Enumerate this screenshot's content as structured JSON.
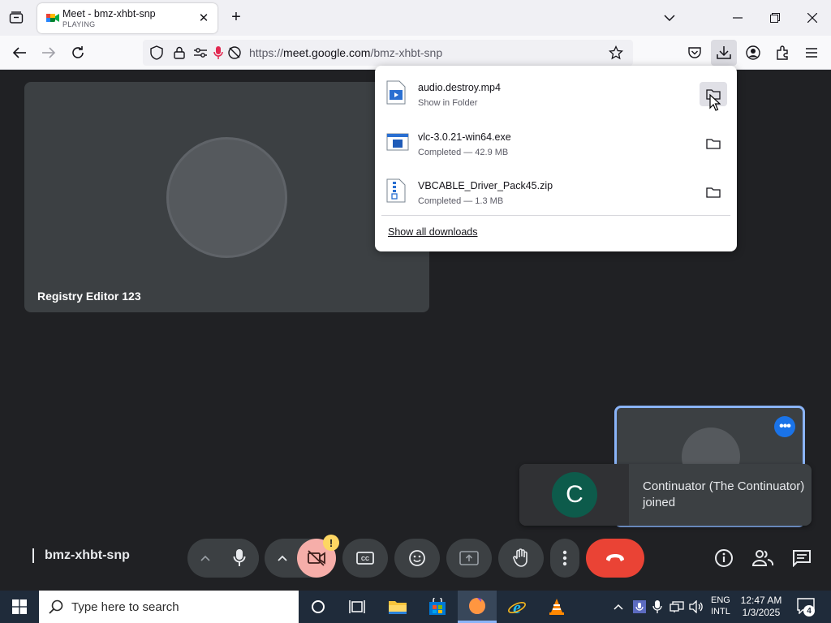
{
  "browser": {
    "tab": {
      "title": "Meet - bmz-xhbt-snp",
      "subtitle": "PLAYING"
    },
    "url": {
      "scheme": "https://",
      "host": "meet.google.com",
      "path": "/bmz-xhbt-snp"
    }
  },
  "downloads": {
    "items": [
      {
        "name": "audio.destroy.mp4",
        "status": "Show in Folder"
      },
      {
        "name": "vlc-3.0.21-win64.exe",
        "status": "Completed — 42.9 MB"
      },
      {
        "name": "VBCABLE_Driver_Pack45.zip",
        "status": "Completed — 1.3 MB"
      }
    ],
    "show_all_label": "Show all downloads"
  },
  "meet": {
    "main_participant": {
      "name": "Registry Editor 123"
    },
    "toast": {
      "initial": "C",
      "message": "Continuator (The Continuator) joined"
    },
    "meeting_code": "bmz-xhbt-snp",
    "video_warning": "!"
  },
  "taskbar": {
    "search_placeholder": "Type here to search",
    "language": {
      "line1": "ENG",
      "line2": "INTL"
    },
    "clock": {
      "time": "12:47 AM",
      "date": "1/3/2025"
    },
    "notification_count": "4"
  },
  "colors": {
    "meet_bg": "#202124",
    "tile": "#3c4043",
    "end_call": "#ea4335",
    "accent_blue": "#1a73e8",
    "video_off": "#f6aea9",
    "toast_avatar": "#0d5b4b"
  }
}
